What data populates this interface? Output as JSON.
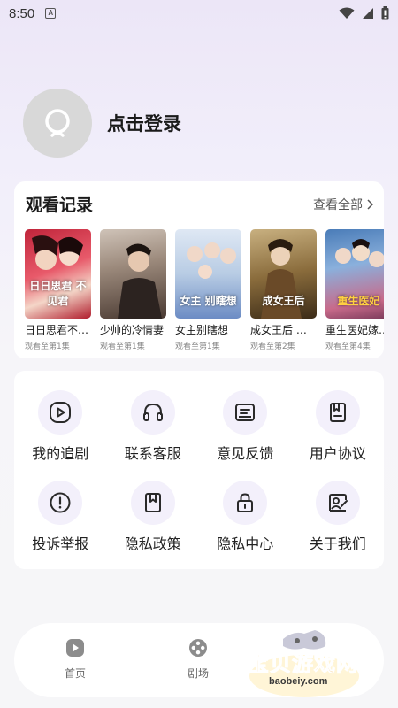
{
  "status": {
    "time": "8:50",
    "notif": "A"
  },
  "profile": {
    "login": "点击登录"
  },
  "history": {
    "title": "观看记录",
    "view_all": "查看全部",
    "items": [
      {
        "title": "日日思君不…",
        "progress": "观看至第1集",
        "caption": "日日思君 不见君"
      },
      {
        "title": "少帅的冷情妻",
        "progress": "观看至第1集",
        "caption": ""
      },
      {
        "title": "女主别瞎想",
        "progress": "观看至第1集",
        "caption": "女主 别瞎想"
      },
      {
        "title": "成女王后 我…",
        "progress": "观看至第2集",
        "caption": "成女王后"
      },
      {
        "title": "重生医妃嫁…",
        "progress": "观看至第4集",
        "caption": "重生医妃"
      }
    ]
  },
  "menu": [
    {
      "label": "我的追剧",
      "icon": "play-circle-icon"
    },
    {
      "label": "联系客服",
      "icon": "headset-icon"
    },
    {
      "label": "意见反馈",
      "icon": "feedback-icon"
    },
    {
      "label": "用户协议",
      "icon": "document-icon"
    },
    {
      "label": "投诉举报",
      "icon": "alert-icon"
    },
    {
      "label": "隐私政策",
      "icon": "bookmark-icon"
    },
    {
      "label": "隐私中心",
      "icon": "lock-icon"
    },
    {
      "label": "关于我们",
      "icon": "about-icon"
    }
  ],
  "nav": [
    {
      "label": "首页",
      "icon": "home-play-icon"
    },
    {
      "label": "剧场",
      "icon": "film-reel-icon"
    }
  ],
  "watermark": {
    "text": "宝贝游戏网",
    "url": "baobeiy.com"
  },
  "colors": {
    "accent": "#f3f0fb",
    "icon": "#2a2a2a",
    "nav_icon": "#8c8c8c"
  }
}
